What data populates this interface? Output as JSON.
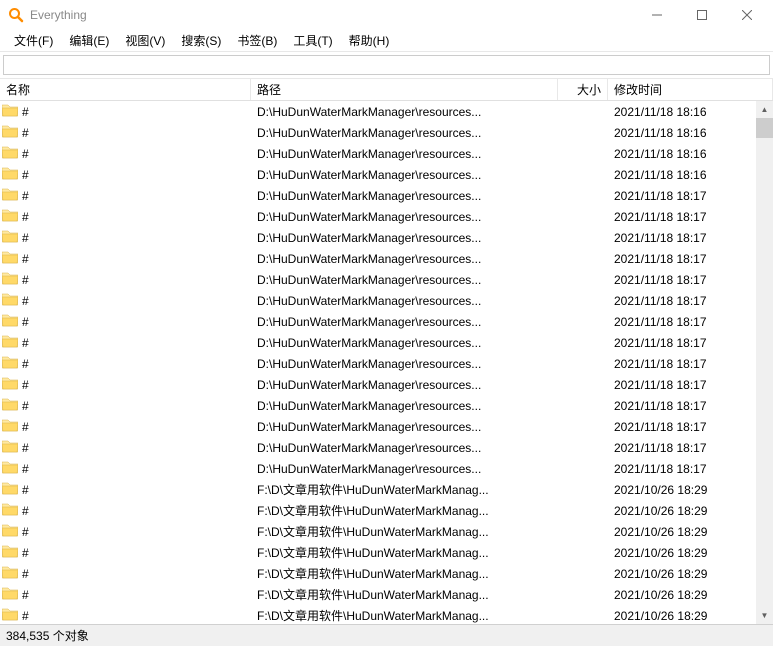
{
  "title": "Everything",
  "menu": {
    "file": "文件(F)",
    "edit": "编辑(E)",
    "view": "视图(V)",
    "search": "搜索(S)",
    "bookmarks": "书签(B)",
    "tools": "工具(T)",
    "help": "帮助(H)"
  },
  "search_value": "",
  "headers": {
    "name": "名称",
    "path": "路径",
    "size": "大小",
    "date": "修改时间"
  },
  "rows": [
    {
      "name": "#",
      "path": "D:\\HuDunWaterMarkManager\\resources...",
      "date": "2021/11/18 18:16"
    },
    {
      "name": "#",
      "path": "D:\\HuDunWaterMarkManager\\resources...",
      "date": "2021/11/18 18:16"
    },
    {
      "name": "#",
      "path": "D:\\HuDunWaterMarkManager\\resources...",
      "date": "2021/11/18 18:16"
    },
    {
      "name": "#",
      "path": "D:\\HuDunWaterMarkManager\\resources...",
      "date": "2021/11/18 18:16"
    },
    {
      "name": "#",
      "path": "D:\\HuDunWaterMarkManager\\resources...",
      "date": "2021/11/18 18:17"
    },
    {
      "name": "#",
      "path": "D:\\HuDunWaterMarkManager\\resources...",
      "date": "2021/11/18 18:17"
    },
    {
      "name": "#",
      "path": "D:\\HuDunWaterMarkManager\\resources...",
      "date": "2021/11/18 18:17"
    },
    {
      "name": "#",
      "path": "D:\\HuDunWaterMarkManager\\resources...",
      "date": "2021/11/18 18:17"
    },
    {
      "name": "#",
      "path": "D:\\HuDunWaterMarkManager\\resources...",
      "date": "2021/11/18 18:17"
    },
    {
      "name": "#",
      "path": "D:\\HuDunWaterMarkManager\\resources...",
      "date": "2021/11/18 18:17"
    },
    {
      "name": "#",
      "path": "D:\\HuDunWaterMarkManager\\resources...",
      "date": "2021/11/18 18:17"
    },
    {
      "name": "#",
      "path": "D:\\HuDunWaterMarkManager\\resources...",
      "date": "2021/11/18 18:17"
    },
    {
      "name": "#",
      "path": "D:\\HuDunWaterMarkManager\\resources...",
      "date": "2021/11/18 18:17"
    },
    {
      "name": "#",
      "path": "D:\\HuDunWaterMarkManager\\resources...",
      "date": "2021/11/18 18:17"
    },
    {
      "name": "#",
      "path": "D:\\HuDunWaterMarkManager\\resources...",
      "date": "2021/11/18 18:17"
    },
    {
      "name": "#",
      "path": "D:\\HuDunWaterMarkManager\\resources...",
      "date": "2021/11/18 18:17"
    },
    {
      "name": "#",
      "path": "D:\\HuDunWaterMarkManager\\resources...",
      "date": "2021/11/18 18:17"
    },
    {
      "name": "#",
      "path": "D:\\HuDunWaterMarkManager\\resources...",
      "date": "2021/11/18 18:17"
    },
    {
      "name": "#",
      "path": "F:\\D\\文章用软件\\HuDunWaterMarkManag...",
      "date": "2021/10/26 18:29"
    },
    {
      "name": "#",
      "path": "F:\\D\\文章用软件\\HuDunWaterMarkManag...",
      "date": "2021/10/26 18:29"
    },
    {
      "name": "#",
      "path": "F:\\D\\文章用软件\\HuDunWaterMarkManag...",
      "date": "2021/10/26 18:29"
    },
    {
      "name": "#",
      "path": "F:\\D\\文章用软件\\HuDunWaterMarkManag...",
      "date": "2021/10/26 18:29"
    },
    {
      "name": "#",
      "path": "F:\\D\\文章用软件\\HuDunWaterMarkManag...",
      "date": "2021/10/26 18:29"
    },
    {
      "name": "#",
      "path": "F:\\D\\文章用软件\\HuDunWaterMarkManag...",
      "date": "2021/10/26 18:29"
    },
    {
      "name": "#",
      "path": "F:\\D\\文章用软件\\HuDunWaterMarkManag...",
      "date": "2021/10/26 18:29"
    }
  ],
  "status": "384,535 个对象"
}
